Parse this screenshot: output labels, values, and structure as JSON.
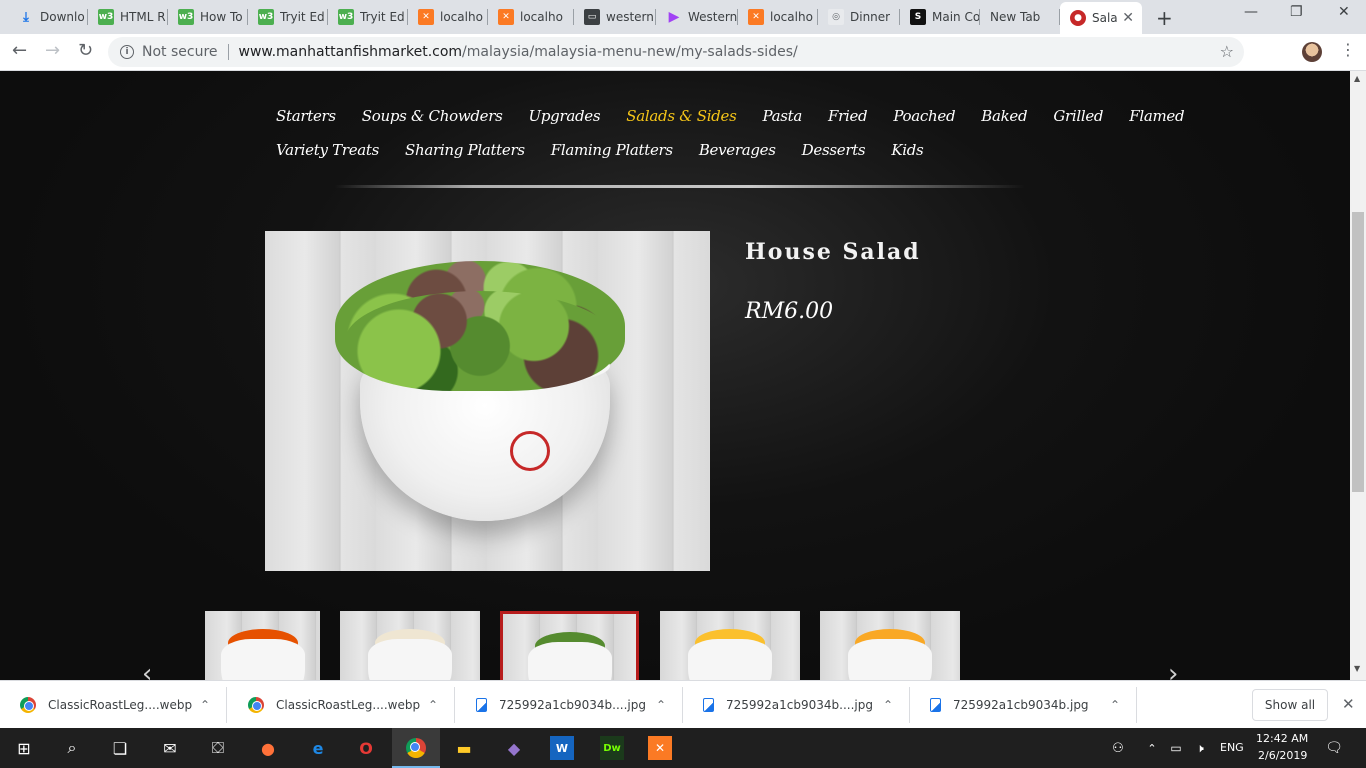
{
  "browser": {
    "tabs": [
      {
        "title": "Downlo",
        "favicon": "download-icon",
        "glyph": "⤓"
      },
      {
        "title": "HTML R",
        "favicon": "w3schools-icon",
        "glyph": "w3"
      },
      {
        "title": "How To",
        "favicon": "w3schools-icon",
        "glyph": "w3"
      },
      {
        "title": "Tryit Ed",
        "favicon": "w3schools-icon",
        "glyph": "w3"
      },
      {
        "title": "Tryit Ed",
        "favicon": "w3schools-icon",
        "glyph": "w3"
      },
      {
        "title": "localho",
        "favicon": "xampp-icon",
        "glyph": "✕"
      },
      {
        "title": "localho",
        "favicon": "xampp-icon",
        "glyph": "✕"
      },
      {
        "title": "western",
        "favicon": "database-icon",
        "glyph": "▭"
      },
      {
        "title": "Western",
        "favicon": "play-icon",
        "glyph": "▶"
      },
      {
        "title": "localho",
        "favicon": "xampp-icon",
        "glyph": "✕"
      },
      {
        "title": "Dinner",
        "favicon": "dinner-icon",
        "glyph": "◎"
      },
      {
        "title": "Main Co",
        "favicon": "s-icon",
        "glyph": "S"
      },
      {
        "title": "New Tab",
        "favicon": "",
        "glyph": ""
      },
      {
        "title": "Sala",
        "favicon": "salad-site-icon",
        "glyph": "●",
        "active": true
      }
    ],
    "security_label": "Not secure",
    "url_host": "www.manhattanfishmarket.com",
    "url_path": "/malaysia/malaysia-menu-new/my-salads-sides/"
  },
  "page": {
    "menu_row1": [
      "Starters",
      "Soups & Chowders",
      "Upgrades",
      "Salads & Sides",
      "Pasta",
      "Fried",
      "Poached",
      "Baked",
      "Grilled",
      "Flamed"
    ],
    "menu_row2": [
      "Variety Treats",
      "Sharing Platters",
      "Flaming Platters",
      "Beverages",
      "Desserts",
      "Kids"
    ],
    "active_menu": "Salads & Sides",
    "accent_color": "#f5c518",
    "product": {
      "name": "House Salad",
      "price": "RM6.00"
    },
    "thumbnails": [
      {
        "name": "thumb-vegetables",
        "food_color": "#e65100"
      },
      {
        "name": "thumb-coleslaw",
        "food_color": "#efe6d2"
      },
      {
        "name": "thumb-house-salad",
        "food_color": "#558b2f",
        "selected": true
      },
      {
        "name": "thumb-corn",
        "food_color": "#fbc02d"
      },
      {
        "name": "thumb-fries",
        "food_color": "#f9a825"
      }
    ]
  },
  "downloads": {
    "items": [
      {
        "name": "ClassicRoastLeg....webp",
        "icon": "chrome-icon"
      },
      {
        "name": "ClassicRoastLeg....webp",
        "icon": "chrome-icon"
      },
      {
        "name": "725992a1cb9034b....jpg",
        "icon": "image-file-icon"
      },
      {
        "name": "725992a1cb9034b....jpg",
        "icon": "image-file-icon"
      },
      {
        "name": "725992a1cb9034b.jpg",
        "icon": "image-file-icon"
      }
    ],
    "show_all": "Show all"
  },
  "taskbar": {
    "language": "ENG",
    "time": "12:42 AM",
    "date": "2/6/2019"
  }
}
